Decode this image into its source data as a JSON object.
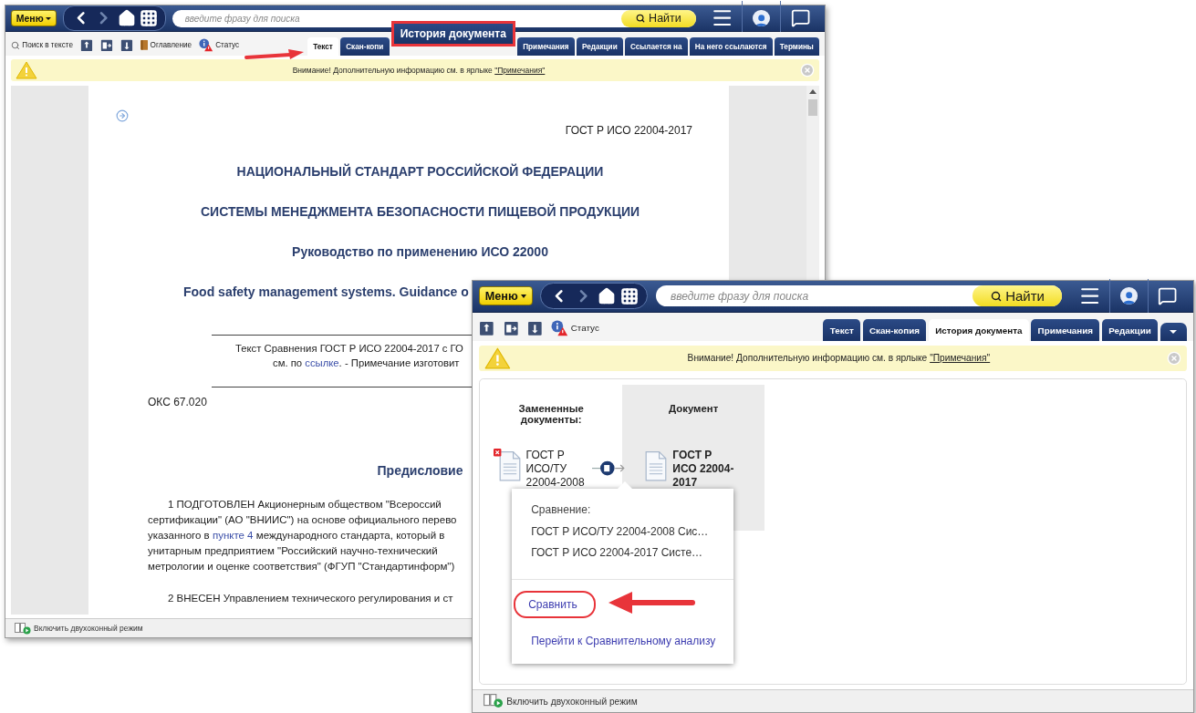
{
  "windows": [
    {
      "kind": "document",
      "menu_button": "Меню",
      "search": {
        "placeholder": "введите фразу для поиска"
      },
      "search_button": "Найти",
      "toolbar": [
        {
          "kind": "search",
          "label": "Поиск в тексте"
        },
        {
          "kind": "export"
        },
        {
          "kind": "split"
        },
        {
          "kind": "import"
        },
        {
          "kind": "contents",
          "label": "Оглавление"
        },
        {
          "kind": "status",
          "label": "Статус"
        }
      ],
      "tabs": [
        {
          "kind": "tab",
          "label": "Текст",
          "selected": true
        },
        {
          "kind": "tab",
          "label": "Скан-копи",
          "selected": false
        },
        {
          "kind": "callout",
          "label": "История документа",
          "selected": false
        },
        {
          "kind": "tab",
          "label": "Примечания",
          "selected": false
        },
        {
          "kind": "tab",
          "label": "Редакции",
          "selected": false
        },
        {
          "kind": "tab",
          "label": "Ссылается на",
          "selected": false
        },
        {
          "kind": "tab",
          "label": "На него ссылаются",
          "selected": false
        },
        {
          "kind": "tab",
          "label": "Термины",
          "selected": false
        }
      ],
      "notice": {
        "text": "Внимание! Дополнительную информацию см. в ярлыке",
        "link": "\"Примечания\""
      },
      "document": {
        "lines": [
          {
            "kind": "code",
            "parts": [
              {
                "kind": "text",
                "text": "ГОСТ Р ИСО 22004-2017"
              }
            ]
          },
          {
            "kind": "heading",
            "parts": [
              {
                "kind": "text",
                "text": "НАЦИОНАЛЬНЫЙ СТАНДАРТ РОССИЙСКОЙ ФЕДЕРАЦИИ"
              }
            ]
          },
          {
            "kind": "heading",
            "parts": [
              {
                "kind": "text",
                "text": "СИСТЕМЫ МЕНЕДЖМЕНТА БЕЗОПАСНОСТИ ПИЩЕВОЙ ПРОДУКЦИИ"
              }
            ]
          },
          {
            "kind": "heading",
            "parts": [
              {
                "kind": "text",
                "text": "Руководство по применению ИСО 22000"
              }
            ]
          },
          {
            "kind": "heading-cut",
            "parts": [
              {
                "kind": "text",
                "text": "Food safety management systems. Guidance o"
              }
            ]
          },
          {
            "kind": "rule"
          },
          {
            "kind": "note",
            "parts": [
              {
                "kind": "text",
                "text": "Текст Сравнения ГОСТ Р ИСО 22004-2017 с ГО"
              }
            ]
          },
          {
            "kind": "note-2",
            "parts": [
              {
                "kind": "text",
                "text": "см. по "
              },
              {
                "kind": "link",
                "text": "ссылке"
              },
              {
                "kind": "text",
                "text": ".  - Примечание изготовит"
              }
            ]
          },
          {
            "kind": "rule"
          },
          {
            "kind": "plain",
            "parts": [
              {
                "kind": "text",
                "text": "ОКС 67.020"
              }
            ]
          },
          {
            "kind": "section",
            "parts": [
              {
                "kind": "text",
                "text": "Предисловие"
              }
            ]
          },
          {
            "kind": "para-first",
            "parts": [
              {
                "kind": "text",
                "text": "1 ПОДГОТОВЛЕН Акционерным обществом \"Всероссий"
              }
            ]
          },
          {
            "kind": "para",
            "parts": [
              {
                "kind": "text",
                "text": "сертификации\" (АО \"ВНИИС\") на основе официального перево"
              }
            ]
          },
          {
            "kind": "para",
            "parts": [
              {
                "kind": "text",
                "text": "указанного в "
              },
              {
                "kind": "link",
                "text": "пункте 4"
              },
              {
                "kind": "text",
                "text": " международного стандарта, который в"
              }
            ]
          },
          {
            "kind": "para",
            "parts": [
              {
                "kind": "text",
                "text": "унитарным предприятием \"Российский научно-технический"
              }
            ]
          },
          {
            "kind": "para",
            "parts": [
              {
                "kind": "text",
                "text": "метрологии и оценке соответствия\" (ФГУП \"Стандартинформ\")"
              }
            ]
          },
          {
            "kind": "para-first",
            "parts": [
              {
                "kind": "text",
                "text": "2 ВНЕСЕН Управлением технического регулирования и ст"
              }
            ]
          }
        ]
      },
      "status_bar": {
        "label": "Включить двухоконный режим"
      }
    },
    {
      "kind": "history",
      "menu_button": "Меню",
      "search": {
        "placeholder": "введите фразу для поиска"
      },
      "search_button": "Найти",
      "toolbar": [
        {
          "kind": "export"
        },
        {
          "kind": "split"
        },
        {
          "kind": "import"
        },
        {
          "kind": "status",
          "label": "Статус"
        }
      ],
      "tabs": [
        {
          "kind": "tab",
          "label": "Текст",
          "selected": false
        },
        {
          "kind": "tab",
          "label": "Скан-копия",
          "selected": false
        },
        {
          "kind": "tab",
          "label": "История документа",
          "selected": true
        },
        {
          "kind": "tab",
          "label": "Примечания",
          "selected": false
        },
        {
          "kind": "tab",
          "label": "Редакции",
          "selected": false
        },
        {
          "kind": "more",
          "selected": false
        }
      ],
      "notice": {
        "text": "Внимание! Дополнительную информацию см. в ярлыке",
        "link": "\"Примечания\""
      },
      "history": {
        "replaced_header": "Замененные документы:",
        "document_header": "Документ",
        "replaced": {
          "title": "ГОСТ Р ИСО/ТУ 22004-2008",
          "cancelled": true
        },
        "current": {
          "title": "ГОСТ Р ИСО 22004-2017",
          "cancelled": false
        },
        "popup": {
          "title": "Сравнение:",
          "items": [
            "ГОСТ Р ИСО/ТУ 22004-2008 Сис…",
            "ГОСТ Р ИСО 22004-2017 Систе…"
          ],
          "actions": [
            {
              "label": "Сравнить",
              "highlighted": true
            },
            {
              "label": "Перейти к Сравнительному анализу",
              "highlighted": false
            }
          ]
        }
      },
      "status_bar": {
        "label": "Включить двухоконный режим"
      }
    }
  ]
}
